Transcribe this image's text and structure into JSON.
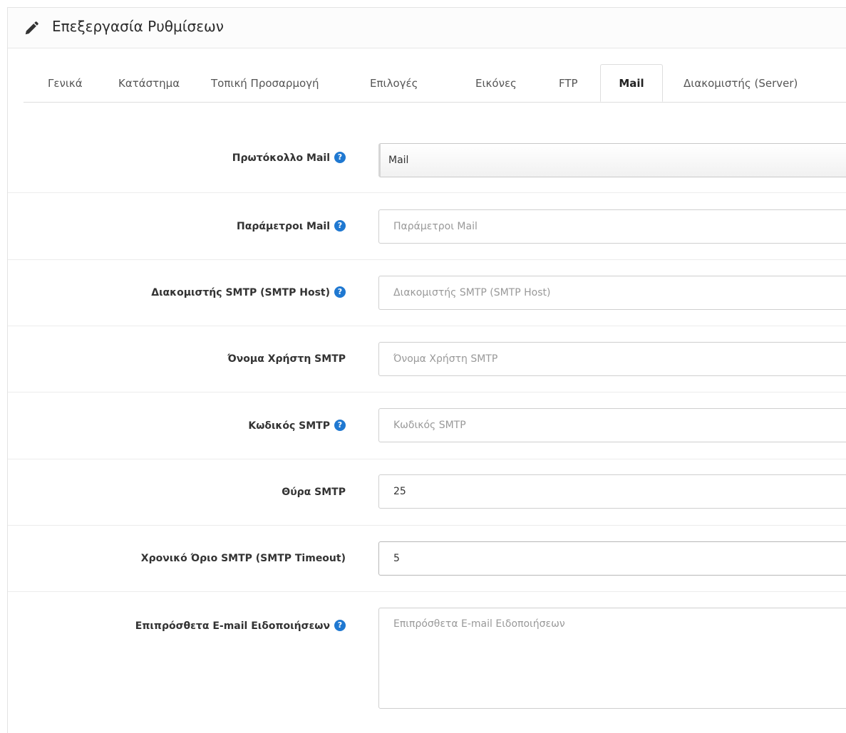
{
  "panel": {
    "title": "Επεξεργασία Ρυθμίσεων",
    "icon": "pencil-icon"
  },
  "tabs": [
    {
      "label": "Γενικά",
      "active": false
    },
    {
      "label": "Κατάστημα",
      "active": false
    },
    {
      "label": "Τοπική Προσαρμογή",
      "active": false
    },
    {
      "label": "Επιλογές",
      "active": false
    },
    {
      "label": "Εικόνες",
      "active": false
    },
    {
      "label": "FTP",
      "active": false
    },
    {
      "label": "Mail",
      "active": true
    },
    {
      "label": "Διακομιστής (Server)",
      "active": false
    }
  ],
  "form": {
    "mail_protocol": {
      "label": "Πρωτόκολλο Mail",
      "value": "Mail",
      "help": "?"
    },
    "mail_parameters": {
      "label": "Παράμετροι Mail",
      "value": "",
      "placeholder": "Παράμετροι Mail",
      "help": "?"
    },
    "smtp_host": {
      "label": "Διακομιστής SMTP (SMTP Host)",
      "value": "",
      "placeholder": "Διακομιστής SMTP (SMTP Host)",
      "help": "?"
    },
    "smtp_username": {
      "label": "Όνομα Χρήστη SMTP",
      "value": "",
      "placeholder": "Όνομα Χρήστη SMTP"
    },
    "smtp_password": {
      "label": "Κωδικός SMTP",
      "value": "",
      "placeholder": "Κωδικός SMTP",
      "help": "?"
    },
    "smtp_port": {
      "label": "Θύρα SMTP",
      "value": "25",
      "placeholder": "Θύρα SMTP"
    },
    "smtp_timeout": {
      "label": "Χρονικό Όριο SMTP (SMTP Timeout)",
      "value": "5",
      "placeholder": "Χρονικό Όριο SMTP (SMTP Timeout)"
    },
    "mail_alert_email": {
      "label": "Επιπρόσθετα E-mail Ειδοποιήσεων",
      "value": "",
      "placeholder": "Επιπρόσθετα E-mail Ειδοποιήσεων",
      "help": "?"
    }
  },
  "colors": {
    "help_icon": "#1f78d1",
    "border": "#dddddd"
  }
}
